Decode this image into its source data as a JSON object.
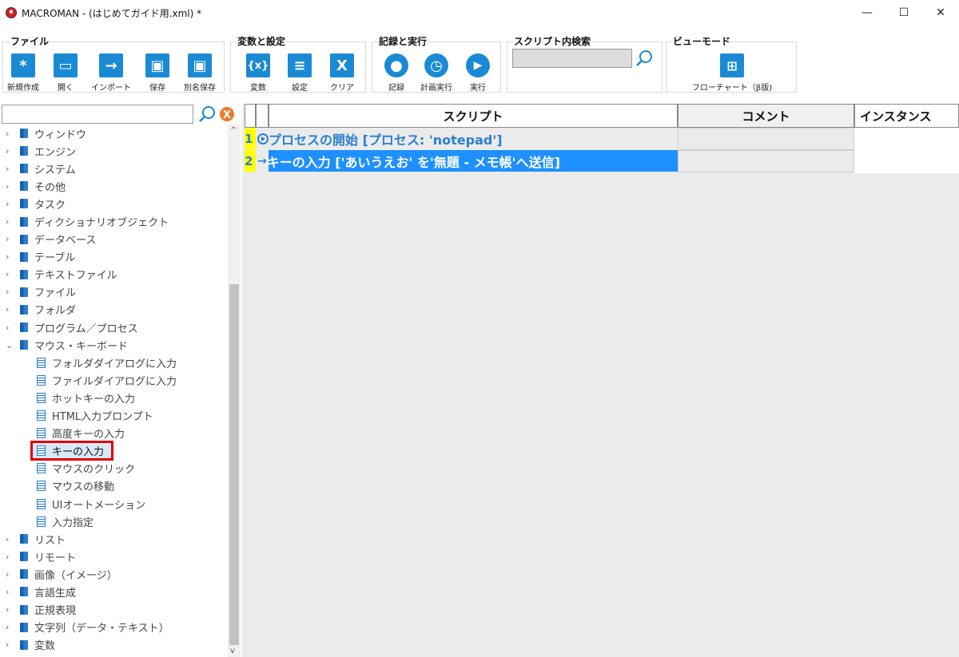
{
  "window": {
    "title": "MACROMAN - (はじめてガイド用.xml) *",
    "controls": {
      "minimize": "—",
      "maximize": "☐",
      "close": "✕"
    }
  },
  "ribbon": {
    "groups": [
      {
        "label": "ファイル",
        "buttons": [
          {
            "label": "新規作成",
            "icon": "asterisk-icon",
            "glyph": "*"
          },
          {
            "label": "開く",
            "icon": "folder-icon",
            "glyph": "▭"
          },
          {
            "label": "インポート",
            "icon": "import-arrow-icon",
            "glyph": "→"
          },
          {
            "label": "保存",
            "icon": "save-icon",
            "glyph": "▣"
          },
          {
            "label": "別名保存",
            "icon": "save-as-icon",
            "glyph": "▣"
          }
        ]
      },
      {
        "label": "変数と設定",
        "buttons": [
          {
            "label": "変数",
            "icon": "variable-icon",
            "glyph": "{x}"
          },
          {
            "label": "設定",
            "icon": "settings-list-icon",
            "glyph": "≡"
          },
          {
            "label": "クリア",
            "icon": "clear-icon",
            "glyph": "X"
          }
        ]
      },
      {
        "label": "記録と実行",
        "buttons": [
          {
            "label": "記録",
            "icon": "record-icon",
            "glyph": "●"
          },
          {
            "label": "計画実行",
            "icon": "schedule-icon",
            "glyph": "◷"
          },
          {
            "label": "実行",
            "icon": "play-icon",
            "glyph": "▶"
          }
        ]
      },
      {
        "label": "スクリプト内検索",
        "search_value": ""
      },
      {
        "label": "ビューモード",
        "buttons": [
          {
            "label": "フローチャート（β版)",
            "icon": "flowchart-icon",
            "glyph": "⊞"
          }
        ]
      }
    ]
  },
  "tree": {
    "search_value": "",
    "categories_before": [
      "ウィンドウ",
      "エンジン",
      "システム",
      "その他",
      "タスク",
      "ディクショナリオブジェクト",
      "データベース",
      "テーブル",
      "テキストファイル",
      "ファイル",
      "フォルダ",
      "プログラム／プロセス"
    ],
    "expanded": {
      "label": "マウス・キーボード",
      "children": [
        "フォルダダイアログに入力",
        "ファイルダイアログに入力",
        "ホットキーの入力",
        "HTML入力プロンプト",
        "高度キーの入力",
        "キーの入力",
        "マウスのクリック",
        "マウスの移動",
        "UIオートメーション",
        "入力指定"
      ],
      "selected_child": "キーの入力"
    },
    "categories_after": [
      "リスト",
      "リモート",
      "画像（イメージ）",
      "言語生成",
      "正規表現",
      "文字列（データ・テキスト）",
      "変数"
    ]
  },
  "script": {
    "headers": {
      "script": "スクリプト",
      "comment": "コメント",
      "instance": "インスタンス"
    },
    "rows": [
      {
        "num": "1",
        "text": "プロセスの開始 [プロセス: 'notepad']",
        "selected": false
      },
      {
        "num": "2",
        "text": "キーの入力 ['あいうえお' を'無題 - メモ帳'へ送信]",
        "selected": true
      }
    ]
  },
  "colors": {
    "accent": "#1a8ad4",
    "selected_row": "#1e90ff",
    "highlight_box": "#e00000",
    "row_number_bg": "#ffff00"
  }
}
